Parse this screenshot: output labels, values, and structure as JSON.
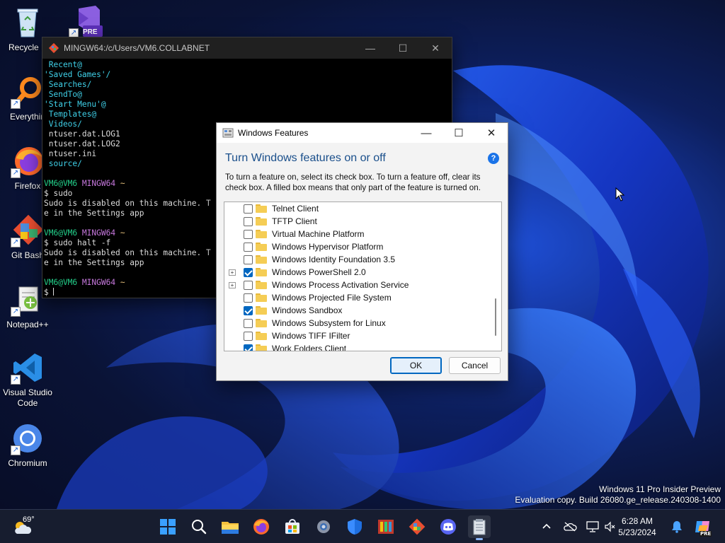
{
  "desktop": {
    "icons": [
      {
        "label": "Recycle Bin",
        "shown": "Recycle B"
      },
      {
        "label": "Everything",
        "shown": "Everythin"
      },
      {
        "label": "Firefox"
      },
      {
        "label": "Git Bash"
      },
      {
        "label": "Notepad++"
      },
      {
        "label": "Visual Studio\nCode",
        "line1": "Visual Studio",
        "line2": "Code"
      },
      {
        "label": "Chromium"
      }
    ],
    "vs_badge": "PRE"
  },
  "terminal": {
    "title": "MINGW64:/c/Users/VM6.COLLABNET",
    "lines": [
      {
        "text": " Recent@",
        "color": "cyan"
      },
      {
        "text": "'Saved Games'/",
        "color": "cyan"
      },
      {
        "text": " Searches/",
        "color": "cyan"
      },
      {
        "text": " SendTo@",
        "color": "cyan"
      },
      {
        "text": "'Start Menu'@",
        "color": "cyan"
      },
      {
        "text": " Templates@",
        "color": "cyan"
      },
      {
        "text": " Videos/",
        "color": "cyan"
      },
      {
        "text": " ntuser.dat.LOG1",
        "color": "white"
      },
      {
        "text": " ntuser.dat.LOG2",
        "color": "white"
      },
      {
        "text": " ntuser.ini",
        "color": "white"
      },
      {
        "text": " source/",
        "color": "cyan"
      },
      {
        "text": "",
        "color": "white"
      },
      {
        "prompt_user": "VM6@VM6",
        "prompt_env": "MINGW64",
        "prompt_path": "~"
      },
      {
        "text": "$ sudo",
        "color": "white"
      },
      {
        "text": "Sudo is disabled on this machine. T",
        "color": "white"
      },
      {
        "text": "e in the Settings app",
        "color": "white"
      },
      {
        "text": "",
        "color": "white"
      },
      {
        "prompt_user": "VM6@VM6",
        "prompt_env": "MINGW64",
        "prompt_path": "~"
      },
      {
        "text": "$ sudo halt -f",
        "color": "white"
      },
      {
        "text": "Sudo is disabled on this machine. T",
        "color": "white"
      },
      {
        "text": "e in the Settings app",
        "color": "white"
      },
      {
        "text": "",
        "color": "white"
      },
      {
        "prompt_user": "VM6@VM6",
        "prompt_env": "MINGW64",
        "prompt_path": "~"
      },
      {
        "text": "$ ",
        "color": "white",
        "cursor": true
      }
    ]
  },
  "dialog": {
    "title": "Windows Features",
    "heading": "Turn Windows features on or off",
    "help": "?",
    "description": "To turn a feature on, select its check box. To turn a feature off, clear its check box. A filled box means that only part of the feature is turned on.",
    "features": [
      {
        "label": "Telnet Client",
        "checked": false,
        "expandable": false
      },
      {
        "label": "TFTP Client",
        "checked": false,
        "expandable": false
      },
      {
        "label": "Virtual Machine Platform",
        "checked": false,
        "expandable": false
      },
      {
        "label": "Windows Hypervisor Platform",
        "checked": false,
        "expandable": false
      },
      {
        "label": "Windows Identity Foundation 3.5",
        "checked": false,
        "expandable": false
      },
      {
        "label": "Windows PowerShell 2.0",
        "checked": true,
        "expandable": true
      },
      {
        "label": "Windows Process Activation Service",
        "checked": false,
        "expandable": true
      },
      {
        "label": "Windows Projected File System",
        "checked": false,
        "expandable": false
      },
      {
        "label": "Windows Sandbox",
        "checked": true,
        "expandable": false
      },
      {
        "label": "Windows Subsystem for Linux",
        "checked": false,
        "expandable": false
      },
      {
        "label": "Windows TIFF IFilter",
        "checked": false,
        "expandable": false
      },
      {
        "label": "Work Folders Client",
        "checked": true,
        "expandable": false
      }
    ],
    "ok_label": "OK",
    "cancel_label": "Cancel"
  },
  "watermark": {
    "line1": "Windows 11 Pro Insider Preview",
    "line2": "Evaluation copy. Build 26080.ge_release.240308-1400"
  },
  "taskbar": {
    "weather_temp": "69°",
    "apps": [
      "start-icon",
      "search-icon",
      "file-explorer-icon",
      "firefox-icon",
      "microsoft-store-icon",
      "settings-icon",
      "windows-security-icon",
      "app-icon",
      "git-icon",
      "discord-icon",
      "notepad-icon"
    ],
    "clock_time": "6:28 AM",
    "clock_date": "5/23/2024",
    "copilot_badge": "PRE"
  },
  "colors": {
    "accent": "#0067c0",
    "terminal_cyan": "#3fd0e8",
    "terminal_green": "#23d18b",
    "terminal_purple": "#c678dd",
    "heading_blue": "#1a4f8b"
  }
}
